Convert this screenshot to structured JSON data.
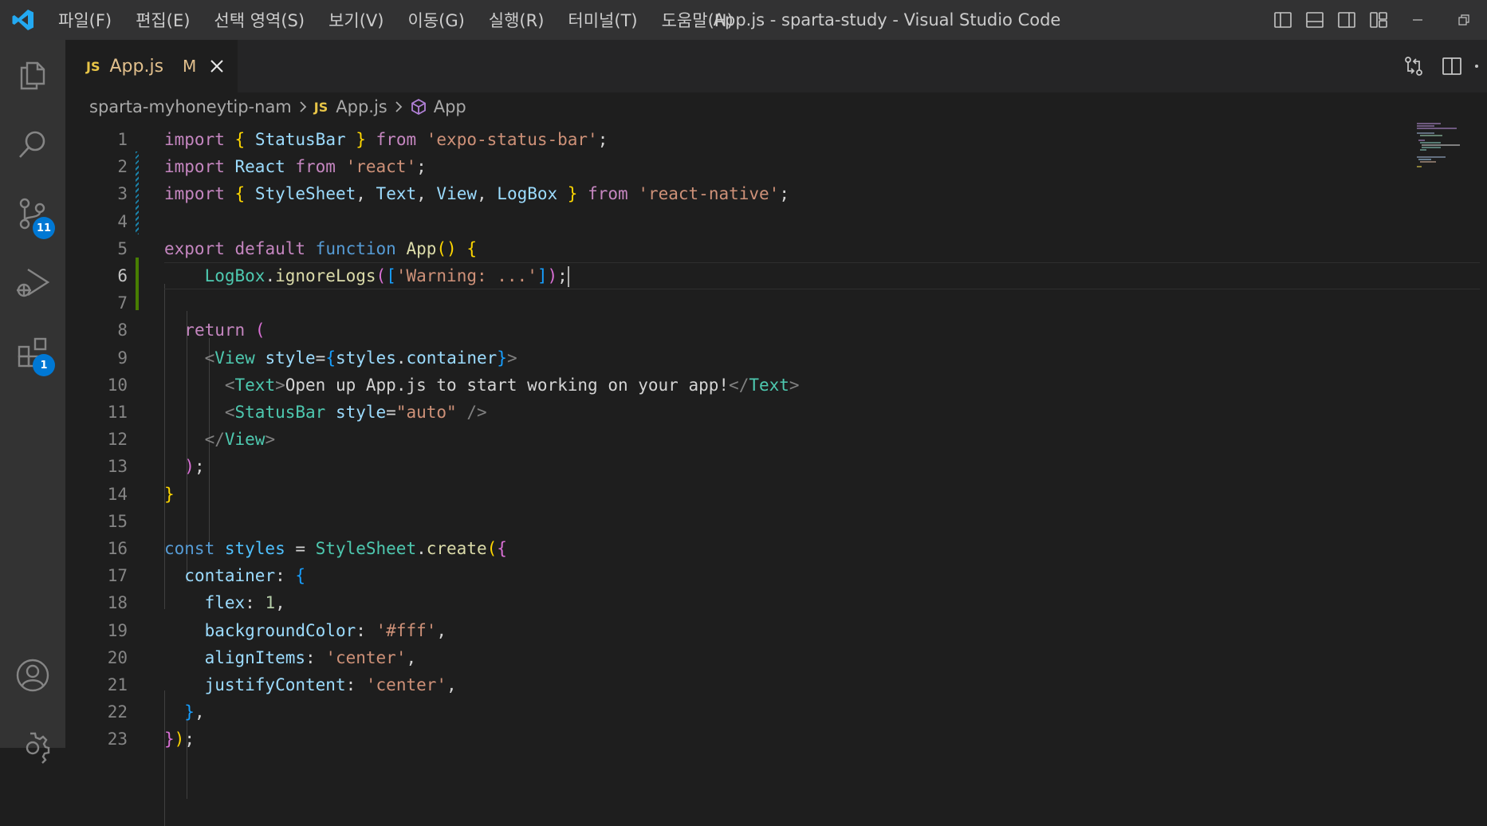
{
  "window": {
    "title": "App.js - sparta-study - Visual Studio Code",
    "menu": [
      "파일(F)",
      "편집(E)",
      "선택 영역(S)",
      "보기(V)",
      "이동(G)",
      "실행(R)",
      "터미널(T)",
      "도움말(H)"
    ]
  },
  "activity": {
    "source_control_badge": "11",
    "extensions_badge": "1",
    "accent_color": "#0078d4"
  },
  "tab": {
    "icon": "JS",
    "label": "App.js",
    "status": "M"
  },
  "breadcrumb": {
    "folder": "sparta-myhoneytip-nam",
    "file_icon": "JS",
    "file": "App.js",
    "symbol": "App"
  },
  "editor": {
    "active_line": 6,
    "lines": [
      [
        [
          "kw",
          "import "
        ],
        [
          "b1",
          "{ "
        ],
        [
          "var",
          "StatusBar"
        ],
        [
          "b1",
          " }"
        ],
        [
          "kw",
          " from "
        ],
        [
          "str",
          "'expo-status-bar'"
        ],
        [
          "txt",
          ";"
        ]
      ],
      [
        [
          "kw",
          "import "
        ],
        [
          "var",
          "React"
        ],
        [
          "kw",
          " from "
        ],
        [
          "str",
          "'react'"
        ],
        [
          "txt",
          ";"
        ]
      ],
      [
        [
          "kw",
          "import "
        ],
        [
          "b1",
          "{ "
        ],
        [
          "var",
          "StyleSheet"
        ],
        [
          "txt",
          ", "
        ],
        [
          "var",
          "Text"
        ],
        [
          "txt",
          ", "
        ],
        [
          "var",
          "View"
        ],
        [
          "txt",
          ", "
        ],
        [
          "var",
          "LogBox"
        ],
        [
          "b1",
          " }"
        ],
        [
          "kw",
          " from "
        ],
        [
          "str",
          "'react-native'"
        ],
        [
          "txt",
          ";"
        ]
      ],
      [],
      [
        [
          "kw",
          "export "
        ],
        [
          "kw",
          "default "
        ],
        [
          "kb",
          "function "
        ],
        [
          "fn",
          "App"
        ],
        [
          "b1",
          "() {"
        ]
      ],
      [
        [
          "txt",
          "    "
        ],
        [
          "cls",
          "LogBox"
        ],
        [
          "txt",
          "."
        ],
        [
          "fn",
          "ignoreLogs"
        ],
        [
          "b2",
          "("
        ],
        [
          "b3",
          "["
        ],
        [
          "str",
          "'Warning: ...'"
        ],
        [
          "b3",
          "]"
        ],
        [
          "b2",
          ")"
        ],
        [
          "txt",
          ";"
        ]
      ],
      [],
      [
        [
          "txt",
          "  "
        ],
        [
          "kw",
          "return "
        ],
        [
          "b2",
          "("
        ]
      ],
      [
        [
          "txt",
          "    "
        ],
        [
          "tag",
          "<"
        ],
        [
          "cls",
          "View"
        ],
        [
          "var",
          " style"
        ],
        [
          "txt",
          "="
        ],
        [
          "b3",
          "{"
        ],
        [
          "var",
          "styles"
        ],
        [
          "txt",
          "."
        ],
        [
          "var",
          "container"
        ],
        [
          "b3",
          "}"
        ],
        [
          "tag",
          ">"
        ]
      ],
      [
        [
          "txt",
          "      "
        ],
        [
          "tag",
          "<"
        ],
        [
          "cls",
          "Text"
        ],
        [
          "tag",
          ">"
        ],
        [
          "txt",
          "Open up App.js to start working on your app!"
        ],
        [
          "tag",
          "</"
        ],
        [
          "cls",
          "Text"
        ],
        [
          "tag",
          ">"
        ]
      ],
      [
        [
          "txt",
          "      "
        ],
        [
          "tag",
          "<"
        ],
        [
          "cls",
          "StatusBar"
        ],
        [
          "var",
          " style"
        ],
        [
          "txt",
          "="
        ],
        [
          "str",
          "\"auto\""
        ],
        [
          "tag",
          " />"
        ]
      ],
      [
        [
          "txt",
          "    "
        ],
        [
          "tag",
          "</"
        ],
        [
          "cls",
          "View"
        ],
        [
          "tag",
          ">"
        ]
      ],
      [
        [
          "txt",
          "  "
        ],
        [
          "b2",
          ")"
        ],
        [
          "txt",
          ";"
        ]
      ],
      [
        [
          "b1",
          "}"
        ]
      ],
      [],
      [
        [
          "kb",
          "const "
        ],
        [
          "cv",
          "styles"
        ],
        [
          "txt",
          " = "
        ],
        [
          "cls",
          "StyleSheet"
        ],
        [
          "txt",
          "."
        ],
        [
          "fn",
          "create"
        ],
        [
          "b1",
          "("
        ],
        [
          "b2",
          "{"
        ]
      ],
      [
        [
          "txt",
          "  "
        ],
        [
          "var",
          "container"
        ],
        [
          "txt",
          ": "
        ],
        [
          "b3",
          "{"
        ]
      ],
      [
        [
          "txt",
          "    "
        ],
        [
          "var",
          "flex"
        ],
        [
          "txt",
          ": "
        ],
        [
          "num",
          "1"
        ],
        [
          "txt",
          ","
        ]
      ],
      [
        [
          "txt",
          "    "
        ],
        [
          "var",
          "backgroundColor"
        ],
        [
          "txt",
          ": "
        ],
        [
          "str",
          "'#fff'"
        ],
        [
          "txt",
          ","
        ]
      ],
      [
        [
          "txt",
          "    "
        ],
        [
          "var",
          "alignItems"
        ],
        [
          "txt",
          ": "
        ],
        [
          "str",
          "'center'"
        ],
        [
          "txt",
          ","
        ]
      ],
      [
        [
          "txt",
          "    "
        ],
        [
          "var",
          "justifyContent"
        ],
        [
          "txt",
          ": "
        ],
        [
          "str",
          "'center'"
        ],
        [
          "txt",
          ","
        ]
      ],
      [
        [
          "txt",
          "  "
        ],
        [
          "b3",
          "}"
        ],
        [
          "txt",
          ","
        ]
      ],
      [
        [
          "b2",
          "}"
        ],
        [
          "b1",
          ")"
        ],
        [
          "txt",
          ";"
        ]
      ]
    ]
  }
}
